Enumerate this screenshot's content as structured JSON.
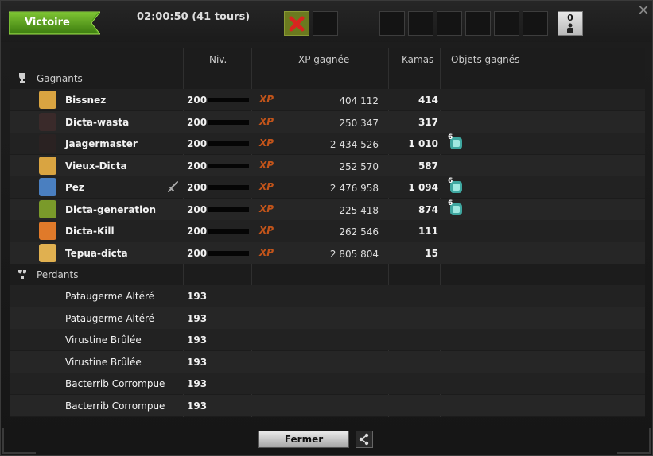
{
  "header": {
    "result_label": "Victoire",
    "duration": "02:00:50 (41 tours)",
    "spectator_count": "0"
  },
  "columns": {
    "level": "Niv.",
    "xp": "XP gagnée",
    "kamas": "Kamas",
    "items": "Objets gagnés"
  },
  "winners": {
    "label": "Gagnants",
    "rows": [
      {
        "name": "Bissnez",
        "level": "200",
        "xp_icon": "XP",
        "xp": "404 112",
        "kamas": "414",
        "item_qty": ""
      },
      {
        "name": "Dicta-wasta",
        "level": "200",
        "xp_icon": "XP",
        "xp": "250 347",
        "kamas": "317",
        "item_qty": ""
      },
      {
        "name": "Jaagermaster",
        "level": "200",
        "xp_icon": "XP",
        "xp": "2 434 526",
        "kamas": "1 010",
        "item_qty": "6"
      },
      {
        "name": "Vieux-Dicta",
        "level": "200",
        "xp_icon": "XP",
        "xp": "252 570",
        "kamas": "587",
        "item_qty": ""
      },
      {
        "name": "Pez",
        "level": "200",
        "xp_icon": "XP",
        "xp": "2 476 958",
        "kamas": "1 094",
        "item_qty": "6"
      },
      {
        "name": "Dicta-generation",
        "level": "200",
        "xp_icon": "XP",
        "xp": "225 418",
        "kamas": "874",
        "item_qty": "6"
      },
      {
        "name": "Dicta-Kill",
        "level": "200",
        "xp_icon": "XP",
        "xp": "262 546",
        "kamas": "111",
        "item_qty": ""
      },
      {
        "name": "Tepua-dicta",
        "level": "200",
        "xp_icon": "XP",
        "xp": "2 805 804",
        "kamas": "15",
        "item_qty": ""
      }
    ]
  },
  "losers": {
    "label": "Perdants",
    "rows": [
      {
        "name": "Pataugerme Altéré",
        "level": "193"
      },
      {
        "name": "Pataugerme Altéré",
        "level": "193"
      },
      {
        "name": "Virustine Brûlée",
        "level": "193"
      },
      {
        "name": "Virustine Brûlée",
        "level": "193"
      },
      {
        "name": "Bacterrib Corrompue",
        "level": "193"
      },
      {
        "name": "Bacterrib Corrompue",
        "level": "193"
      }
    ]
  },
  "footer": {
    "close_label": "Fermer"
  },
  "icons": {
    "close": "close-icon",
    "trophy": "trophy-icon",
    "broken_trophy": "broken-trophy-icon",
    "sword": "sword-icon",
    "share": "share-icon",
    "spectator": "spectator-icon",
    "fail": "red-cross-icon"
  },
  "colors": {
    "victory": "#5fa822",
    "xp": "#c2541a",
    "background": "#1c1c1c"
  }
}
